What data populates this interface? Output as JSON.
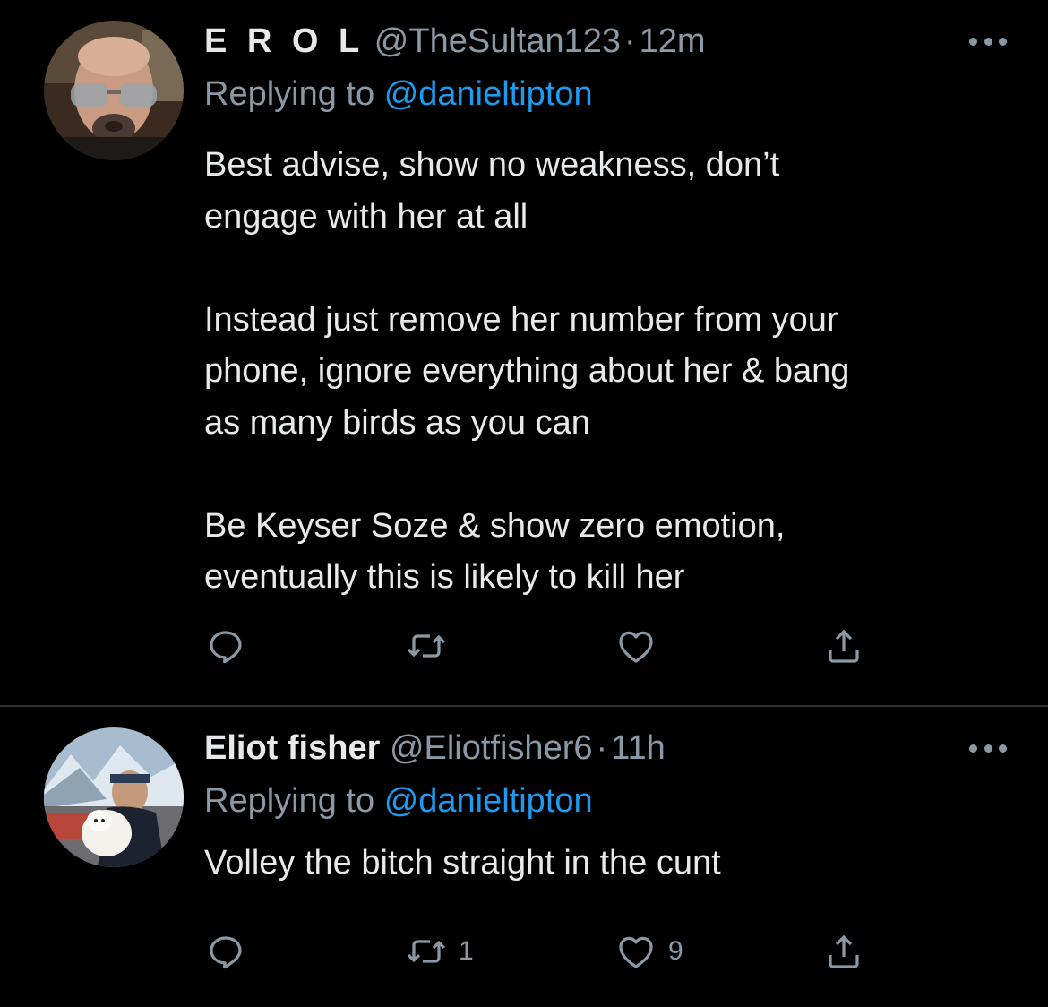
{
  "tweets": [
    {
      "display_name": "E R O L",
      "handle": "@TheSultan123",
      "separator": "·",
      "time": "12m",
      "replying_label": "Replying to",
      "replying_to": "@danieltipton",
      "text": "Best advise, show no weakness, don’t\nengage with her at all\n\nInstead just remove her number from your\nphone, ignore everything about her & bang\nas many birds as you can\n\nBe Keyser Soze & show zero emotion,\neventually this is likely to kill her",
      "actions": {
        "reply_icon": "reply-icon",
        "retweet_icon": "retweet-icon",
        "like_icon": "like-icon",
        "share_icon": "share-icon",
        "reply_count": "",
        "retweet_count": "",
        "like_count": ""
      }
    },
    {
      "display_name": "Eliot fisher",
      "handle": "@Eliotfisher6",
      "separator": "·",
      "time": "11h",
      "replying_label": "Replying to",
      "replying_to": "@danieltipton",
      "text": "Volley the bitch straight in the cunt",
      "actions": {
        "reply_icon": "reply-icon",
        "retweet_icon": "retweet-icon",
        "like_icon": "like-icon",
        "share_icon": "share-icon",
        "reply_count": "",
        "retweet_count": "1",
        "like_count": "9"
      }
    }
  ],
  "colors": {
    "background": "#000000",
    "text": "#e7e9ea",
    "secondary": "#8b98a5",
    "link": "#1d9bf0",
    "divider": "#2f3336"
  }
}
